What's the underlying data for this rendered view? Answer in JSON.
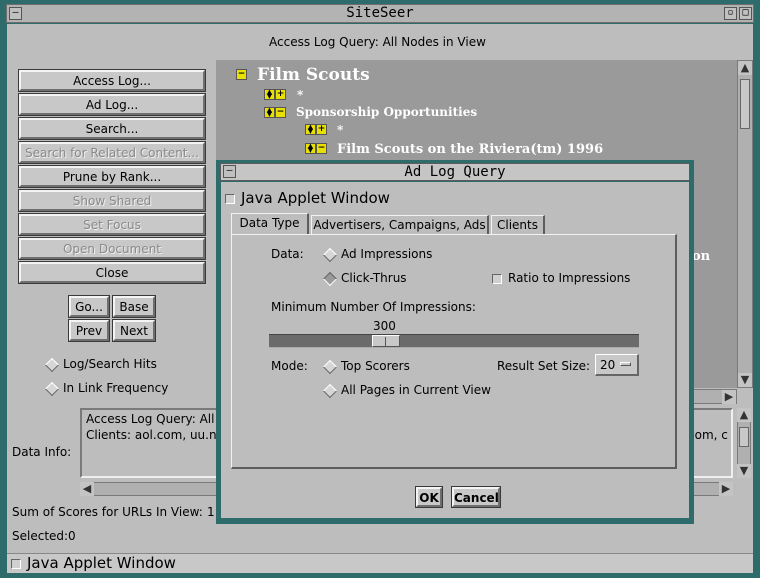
{
  "window": {
    "title": "SiteSeer"
  },
  "header": {
    "title": "Access Log Query: All Nodes in View"
  },
  "side_buttons": [
    {
      "label": "Access Log...",
      "enabled": true
    },
    {
      "label": "Ad Log...",
      "enabled": true
    },
    {
      "label": "Search...",
      "enabled": true
    },
    {
      "label": "Search for Related Content...",
      "enabled": false
    },
    {
      "label": "Prune by Rank...",
      "enabled": true
    },
    {
      "label": "Show Shared",
      "enabled": false
    },
    {
      "label": "Set Focus",
      "enabled": false
    },
    {
      "label": "Open Document",
      "enabled": false
    },
    {
      "label": "Close",
      "enabled": true
    }
  ],
  "nav": {
    "go": "Go...",
    "base": "Base",
    "prev": "Prev",
    "next": "Next"
  },
  "mode_radios": [
    {
      "label": "Log/Search Hits",
      "selected": false
    },
    {
      "label": "In Link Frequency",
      "selected": false
    }
  ],
  "tree": {
    "root": "Film Scouts",
    "star1": "*",
    "node1": "Sponsorship Opportunities",
    "star2": "*",
    "node2": "Film Scouts on the Riviera(tm) 1996",
    "partial": "on"
  },
  "data_info": {
    "label": "Data Info:",
    "line1": "Access Log Query: All",
    "line2": "Clients: aol.com, uu.ne",
    "line2_tail": "com, c"
  },
  "sum_scores": {
    "label": "Sum of Scores for URLs In View:",
    "value": "1"
  },
  "selected": {
    "label": "Selected:",
    "value": "0"
  },
  "status_bar": "Java Applet Window",
  "dialog": {
    "title": "Ad Log Query",
    "applet_label": "Java Applet Window",
    "tabs": [
      "Data Type",
      "Advertisers, Campaigns, Ads",
      "Clients"
    ],
    "data_label": "Data:",
    "data_options": [
      {
        "label": "Ad Impressions",
        "selected": false
      },
      {
        "label": "Click-Thrus",
        "selected": true
      }
    ],
    "ratio_label": "Ratio to Impressions",
    "ratio_checked": false,
    "min_impressions_label": "Minimum Number Of Impressions:",
    "slider_value": "300",
    "mode_label": "Mode:",
    "mode_options": [
      {
        "label": "Top Scorers",
        "selected": false
      },
      {
        "label": "All Pages in Current View",
        "selected": false
      }
    ],
    "result_size_label": "Result Set Size:",
    "result_size_value": "20",
    "ok": "OK",
    "cancel": "Cancel"
  }
}
